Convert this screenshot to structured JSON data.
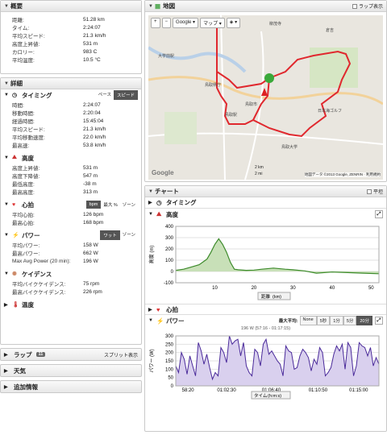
{
  "summary": {
    "title": "概要",
    "rows": [
      [
        "距離:",
        "51.28 km"
      ],
      [
        "タイム:",
        "2:24:07"
      ],
      [
        "平均スピード:",
        "21.3 km/h"
      ],
      [
        "高度上昇値:",
        "531 m"
      ],
      [
        "カロリー:",
        "983 C"
      ],
      [
        "平均温度:",
        "10.5 °C"
      ]
    ]
  },
  "detail": {
    "title": "詳細",
    "timing": {
      "title": "タイミング",
      "pace": "ペース",
      "speed": "スピード",
      "rows": [
        [
          "時間:",
          "2:24:07"
        ],
        [
          "移動時間:",
          "2:20:04"
        ],
        [
          "経過時間:",
          "15:45:04"
        ],
        [
          "平均スピード:",
          "21.3 km/h"
        ],
        [
          "平均移動速度:",
          "22.0 km/h"
        ],
        [
          "最高速:",
          "53.8 km/h"
        ]
      ]
    },
    "elevation": {
      "title": "高度",
      "rows": [
        [
          "高度上昇値:",
          "531 m"
        ],
        [
          "高度下降値:",
          "547 m"
        ],
        [
          "最低高度:",
          "-38 m"
        ],
        [
          "最高高度:",
          "313 m"
        ]
      ]
    },
    "heart": {
      "title": "心拍",
      "bpm": "bpm",
      "maxpct": "最大 %",
      "zone": "ゾーン",
      "rows": [
        [
          "平均心拍:",
          "126 bpm"
        ],
        [
          "最高心拍:",
          "168 bpm"
        ]
      ]
    },
    "power": {
      "title": "パワー",
      "watt": "ワット",
      "zone": "ゾーン",
      "rows": [
        [
          "平均パワー:",
          "158 W"
        ],
        [
          "最高パワー:",
          "662 W"
        ],
        [
          "Max Avg Power (20 min):",
          "196 W"
        ]
      ]
    },
    "cadence": {
      "title": "ケイデンス",
      "rows": [
        [
          "平均バイクケイデンス:",
          "75 rpm"
        ],
        [
          "最高バイクケイデンス:",
          "226 rpm"
        ]
      ]
    },
    "temp": {
      "title": "温度"
    }
  },
  "laps": {
    "title": "ラップ",
    "count": "11",
    "split": "スプリット表示"
  },
  "weather": {
    "title": "天気"
  },
  "extra": {
    "title": "追加情報"
  },
  "map": {
    "title": "地図",
    "lap_display": "ラップ表示",
    "zoom_in": "+",
    "zoom_out": "−",
    "provider": "Google",
    "maptype": "マップ",
    "footer": "地図データ ©2013 Google, ZENRIN · 利用規約",
    "logo": "Google",
    "scale1": "2 km",
    "scale2": "2 mi",
    "labels": [
      "柳茂寺",
      "大学前駅",
      "鳥取県庁",
      "鳥取駅",
      "鳥取市",
      "鳥取大学",
      "日本海ゴルフ",
      "倉吉"
    ]
  },
  "chart": {
    "title": "チャート",
    "flat": "平坦",
    "timing": "タイミング",
    "elevation": {
      "title": "高度",
      "ylabel": "高度 (m)",
      "xlabel": "距離",
      "xunit": "(km)"
    },
    "heart": "心拍",
    "power": {
      "title": "パワー",
      "maxavg": "最大平均:",
      "opts": [
        "None",
        "5秒",
        "1分",
        "5分",
        "20分"
      ],
      "selected": "20分",
      "note": "196 W (57:16 - 01:17:15)",
      "ylabel": "パワー (W)",
      "xlabel": "タイム",
      "xunit": "(h:m:s)"
    }
  },
  "chart_data": [
    {
      "type": "area",
      "title": "",
      "xlabel": "距離 (km)",
      "ylabel": "高度 (m)",
      "xlim": [
        0,
        52
      ],
      "ylim": [
        -100,
        400
      ],
      "xticks": [
        10,
        20,
        30,
        40,
        50
      ],
      "yticks": [
        -100,
        0,
        100,
        200,
        300,
        400
      ],
      "x": [
        0,
        2,
        4,
        6,
        8,
        9,
        10,
        11,
        12,
        13,
        14,
        15,
        16,
        18,
        20,
        22,
        25,
        28,
        30,
        33,
        36,
        40,
        44,
        48,
        52
      ],
      "y": [
        10,
        20,
        40,
        60,
        110,
        170,
        240,
        290,
        240,
        170,
        80,
        20,
        15,
        10,
        12,
        20,
        30,
        20,
        15,
        5,
        -15,
        -5,
        -10,
        -15,
        -20
      ]
    },
    {
      "type": "area",
      "title": "",
      "xlabel": "タイム (h:m:s)",
      "ylabel": "パワー (W)",
      "ylim": [
        0,
        300
      ],
      "xticks": [
        "58:20",
        "01:02:30",
        "01:06:40",
        "01:10:50",
        "01:15:00"
      ],
      "yticks": [
        0,
        50,
        100,
        150,
        200,
        250,
        300
      ],
      "y": [
        120,
        80,
        200,
        160,
        70,
        180,
        120,
        60,
        260,
        210,
        130,
        190,
        110,
        40,
        80,
        60,
        230,
        200,
        140,
        300,
        250,
        270,
        280,
        180,
        260,
        120,
        80,
        60,
        220,
        200,
        120,
        250,
        280,
        190,
        210,
        180,
        150,
        130,
        60,
        240,
        210,
        200,
        100,
        110,
        180,
        220,
        200,
        170,
        90,
        160,
        130,
        230,
        200,
        60,
        80,
        110,
        190,
        240,
        210,
        250,
        100,
        260,
        230,
        60,
        120,
        260,
        240,
        230,
        180,
        230,
        120,
        170,
        130
      ]
    }
  ]
}
